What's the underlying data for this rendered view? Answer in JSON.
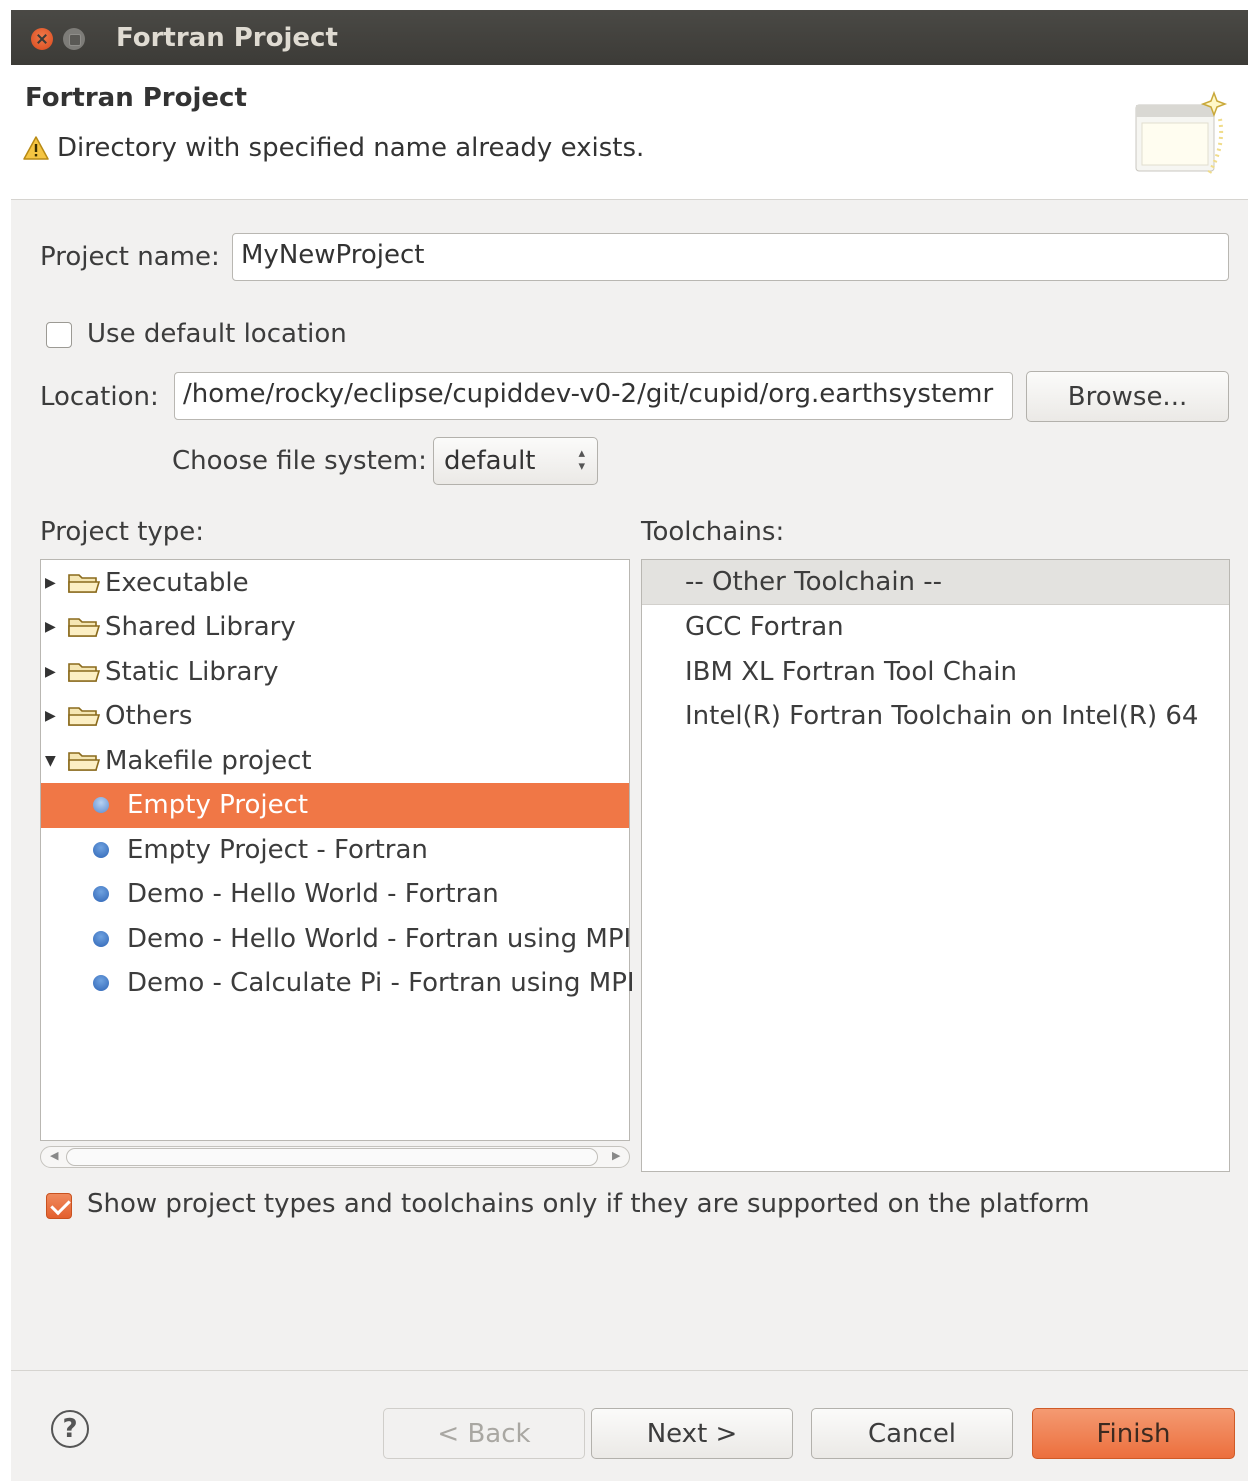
{
  "window": {
    "title": "Fortran Project"
  },
  "banner": {
    "heading": "Fortran Project",
    "message": "Directory with specified name already exists."
  },
  "form": {
    "project_name_label": "Project name:",
    "project_name_value": "MyNewProject",
    "use_default_location_label": "Use default location",
    "use_default_location_checked": false,
    "location_label": "Location:",
    "location_value": "/home/rocky/eclipse/cupiddev-v0-2/git/cupid/org.earthsystemr",
    "browse_label": "Browse...",
    "file_system_label": "Choose file system:",
    "file_system_value": "default"
  },
  "project_type": {
    "label": "Project type:",
    "folders": [
      "Executable",
      "Shared Library",
      "Static Library",
      "Others",
      "Makefile project"
    ],
    "makefile_children": [
      "Empty Project",
      "Empty Project - Fortran",
      "Demo - Hello World - Fortran",
      "Demo - Hello World - Fortran using MPI",
      "Demo - Calculate Pi - Fortran using MPI"
    ],
    "selected": "Empty Project"
  },
  "toolchains": {
    "label": "Toolchains:",
    "items": [
      "-- Other Toolchain --",
      "GCC Fortran",
      "IBM XL Fortran Tool Chain",
      "Intel(R) Fortran Toolchain on Intel(R) 64"
    ],
    "selected": "-- Other Toolchain --"
  },
  "filter": {
    "label": "Show project types and toolchains only if they are supported on the platform",
    "checked": true
  },
  "buttons": {
    "back": "< Back",
    "next": "Next >",
    "cancel": "Cancel",
    "finish": "Finish"
  },
  "colors": {
    "accent": "#f07746",
    "titlebar": "#3c3b37",
    "dialog_bg": "#f2f1f0"
  }
}
